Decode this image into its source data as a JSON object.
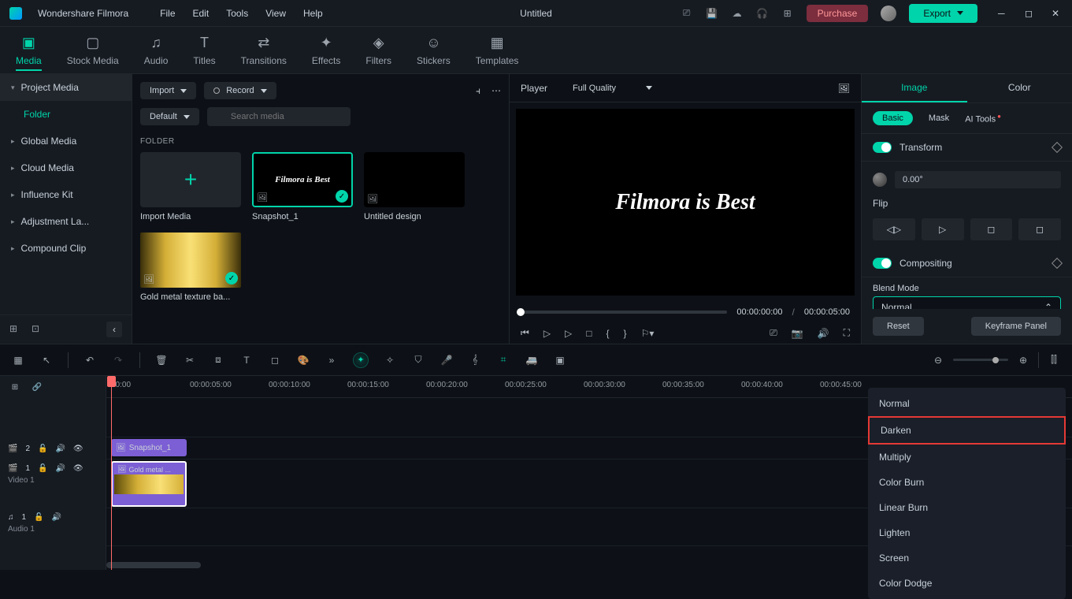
{
  "app": {
    "name": "Wondershare Filmora",
    "doc": "Untitled"
  },
  "menus": [
    "File",
    "Edit",
    "Tools",
    "View",
    "Help"
  ],
  "purchase": "Purchase",
  "export": "Export",
  "toolTabs": [
    {
      "k": "media",
      "label": "Media",
      "ic": "▣"
    },
    {
      "k": "stock",
      "label": "Stock Media",
      "ic": "▢"
    },
    {
      "k": "audio",
      "label": "Audio",
      "ic": "♫"
    },
    {
      "k": "titles",
      "label": "Titles",
      "ic": "T"
    },
    {
      "k": "trans",
      "label": "Transitions",
      "ic": "⇄"
    },
    {
      "k": "effects",
      "label": "Effects",
      "ic": "✦"
    },
    {
      "k": "filters",
      "label": "Filters",
      "ic": "◈"
    },
    {
      "k": "stickers",
      "label": "Stickers",
      "ic": "☺"
    },
    {
      "k": "templates",
      "label": "Templates",
      "ic": "▦"
    }
  ],
  "sidebar": {
    "hdr": "Project Media",
    "sub": "Folder",
    "items": [
      "Global Media",
      "Cloud Media",
      "Influence Kit",
      "Adjustment La...",
      "Compound Clip"
    ]
  },
  "mediaPanel": {
    "import": "Import",
    "record": "Record",
    "default": "Default",
    "searchPh": "Search media",
    "folderLbl": "FOLDER",
    "thumbs": [
      {
        "label": "Import Media",
        "type": "import"
      },
      {
        "label": "Snapshot_1",
        "type": "snap",
        "txt": "Filmora is Best",
        "sel": true,
        "check": true
      },
      {
        "label": "Untitled design",
        "type": "dark"
      },
      {
        "label": "Gold metal texture ba...",
        "type": "gold",
        "check": true
      }
    ]
  },
  "player": {
    "lbl": "Player",
    "quality": "Full Quality",
    "text": "Filmora is Best",
    "cur": "00:00:00:00",
    "dur": "00:00:05:00"
  },
  "rightPanel": {
    "tabs": [
      "Image",
      "Color"
    ],
    "subtabs": [
      "Basic",
      "Mask",
      "AI Tools"
    ],
    "transform": "Transform",
    "deg": "0.00°",
    "flip": "Flip",
    "compositing": "Compositing",
    "blendLbl": "Blend Mode",
    "blendSel": "Normal",
    "options": [
      "Normal",
      "Darken",
      "Multiply",
      "Color Burn",
      "Linear Burn",
      "Lighten",
      "Screen",
      "Color Dodge"
    ],
    "reset": "Reset",
    "keyframe": "Keyframe Panel"
  },
  "ruler": [
    "00:00",
    "00:00:05:00",
    "00:00:10:00",
    "00:00:15:00",
    "00:00:20:00",
    "00:00:25:00",
    "00:00:30:00",
    "00:00:35:00",
    "00:00:40:00",
    "00:00:45:00"
  ],
  "tracks": {
    "t2": {
      "lbl": "2",
      "clip": "Snapshot_1"
    },
    "t1": {
      "lbl": "1",
      "labelTxt": "Video 1",
      "clip": "Gold metal ..."
    },
    "a1": {
      "lbl": "1",
      "labelTxt": "Audio 1"
    }
  }
}
